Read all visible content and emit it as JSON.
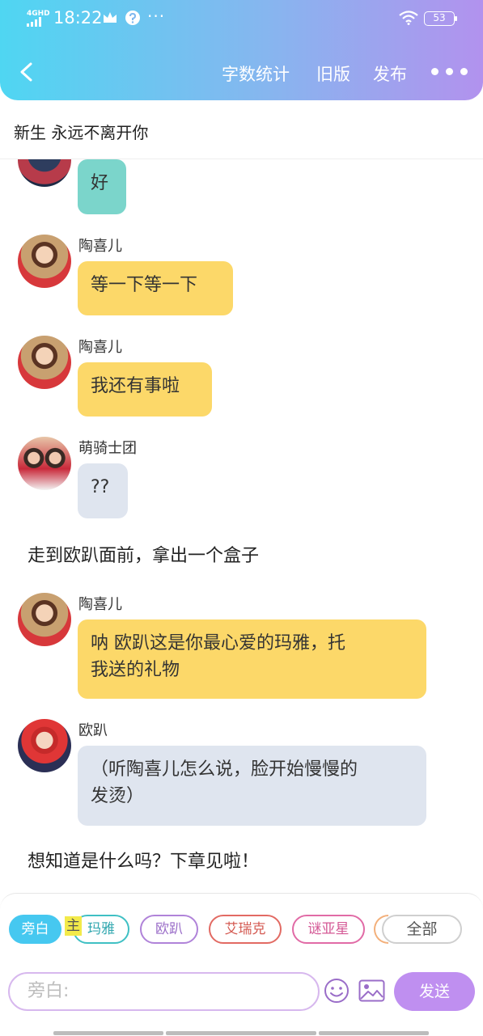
{
  "status_bar": {
    "network": "4GHD",
    "time": "18:22",
    "dots": "···",
    "battery": "53"
  },
  "header": {
    "back_icon": "back-arrow-icon",
    "word_count": "字数统计",
    "old_version": "旧版",
    "publish": "发布",
    "more_icon": "more-dots-icon"
  },
  "chapter_title": "新生  永远不离开你",
  "messages": [
    {
      "type": "bubble",
      "speaker": "",
      "text": "好",
      "color": "#7bd5cb"
    },
    {
      "type": "bubble",
      "speaker": "陶喜儿",
      "text": "等一下等一下",
      "color": "#fcd869"
    },
    {
      "type": "bubble",
      "speaker": "陶喜儿",
      "text": "我还有事啦",
      "color": "#fcd869"
    },
    {
      "type": "bubble",
      "speaker": "萌骑士团",
      "text": "??",
      "color": "#dfe5ef"
    },
    {
      "type": "narration",
      "text": "走到欧趴面前，拿出一个盒子"
    },
    {
      "type": "bubble",
      "speaker": "陶喜儿",
      "text_lines": [
        "呐 欧趴这是你最心爱的玛雅，托",
        "我送的礼物"
      ],
      "color": "#fcd869"
    },
    {
      "type": "bubble",
      "speaker": "欧趴",
      "text_lines": [
        "（听陶喜儿怎么说，脸开始慢慢的",
        "发烫）"
      ],
      "color": "#dfe5ef"
    },
    {
      "type": "narration",
      "text": "想知道是什么吗？下章见啦！"
    }
  ],
  "composer": {
    "roles": [
      {
        "label": "旁白",
        "color": "#46c8f0",
        "selected": true
      },
      {
        "label": "玛雅",
        "color": "#3fc0c4"
      },
      {
        "label": "欧趴",
        "color": "#b083d9"
      },
      {
        "label": "艾瑞克",
        "color": "#e26a63"
      },
      {
        "label": "谜亚星",
        "color": "#e16ba6"
      }
    ],
    "main_badge": "主",
    "all_label": "全部",
    "input_placeholder": "旁白:",
    "emoji_icon": "emoji-icon",
    "image_icon": "image-icon",
    "send_label": "发送"
  },
  "colors": {
    "header_gradient": [
      "#4fd6f2",
      "#86b6ef",
      "#b292ee"
    ],
    "send": "#bf8ff0"
  }
}
